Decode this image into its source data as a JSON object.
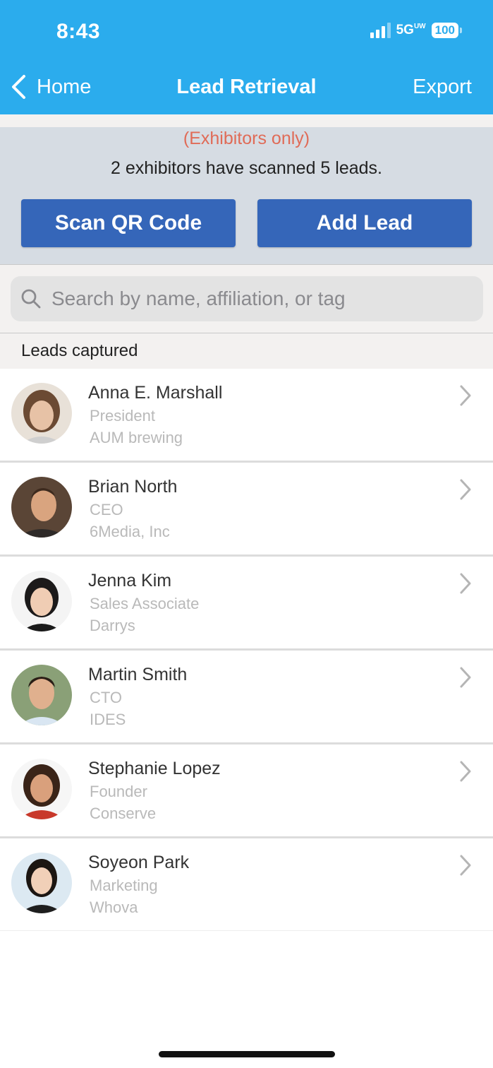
{
  "status_bar": {
    "time": "8:43",
    "network": "5G",
    "network_suffix": "UW",
    "battery": "100"
  },
  "nav": {
    "back_label": "Home",
    "title": "Lead Retrieval",
    "export_label": "Export"
  },
  "exhibitor": {
    "note": "(Exhibitors only)",
    "summary": "2 exhibitors have scanned 5 leads.",
    "scan_button": "Scan QR Code",
    "add_button": "Add Lead"
  },
  "search": {
    "placeholder": "Search by name, affiliation, or tag",
    "value": ""
  },
  "section_title": "Leads captured",
  "leads": [
    {
      "name": "Anna E. Marshall",
      "title": "President",
      "company": "AUM brewing"
    },
    {
      "name": "Brian North",
      "title": "CEO",
      "company": "6Media, Inc"
    },
    {
      "name": "Jenna Kim",
      "title": "Sales Associate",
      "company": "Darrys"
    },
    {
      "name": "Martin Smith",
      "title": "CTO",
      "company": "IDES"
    },
    {
      "name": "Stephanie Lopez",
      "title": "Founder",
      "company": "Conserve"
    },
    {
      "name": "Soyeon Park",
      "title": "Marketing",
      "company": "Whova"
    }
  ],
  "colors": {
    "header_blue": "#2baced",
    "button_blue": "#3566b9",
    "note_red": "#e06b57"
  }
}
